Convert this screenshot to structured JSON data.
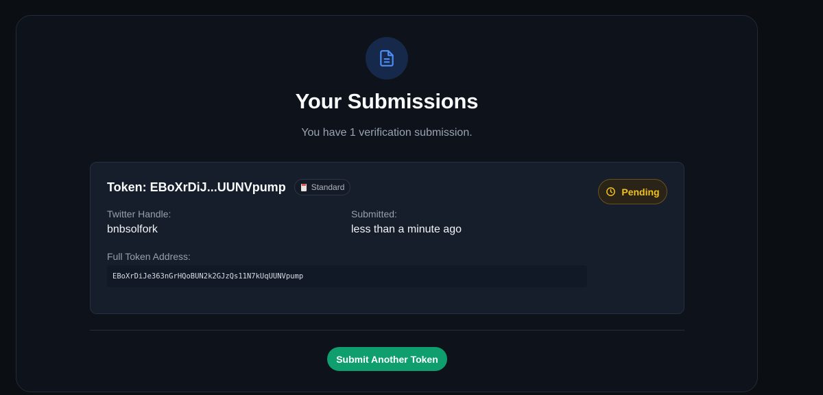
{
  "header": {
    "icon": "document-icon",
    "title": "Your Submissions",
    "subtitle": "You have 1 verification submission."
  },
  "submission": {
    "token_title": "Token: EBoXrDiJ...UUNVpump",
    "tier": {
      "icon": "clipboard-icon",
      "label": "Standard"
    },
    "status": {
      "icon": "clock-icon",
      "label": "Pending",
      "color": "#f1c21b"
    },
    "twitter_label": "Twitter Handle:",
    "twitter_value": "bnbsolfork",
    "submitted_label": "Submitted:",
    "submitted_value": "less than a minute ago",
    "address_label": "Full Token Address:",
    "address_value": "EBoXrDiJe363nGrHQoBUN2k2GJzQs11N7kUqUUNVpump"
  },
  "footer": {
    "submit_button_label": "Submit Another Token"
  },
  "colors": {
    "background": "#0b0e13",
    "panel": "#0d121b",
    "card": "#161d2b",
    "accent_blue": "#3b82f6",
    "button_green": "#0f9f6e",
    "pending_yellow": "#f1c21b"
  }
}
